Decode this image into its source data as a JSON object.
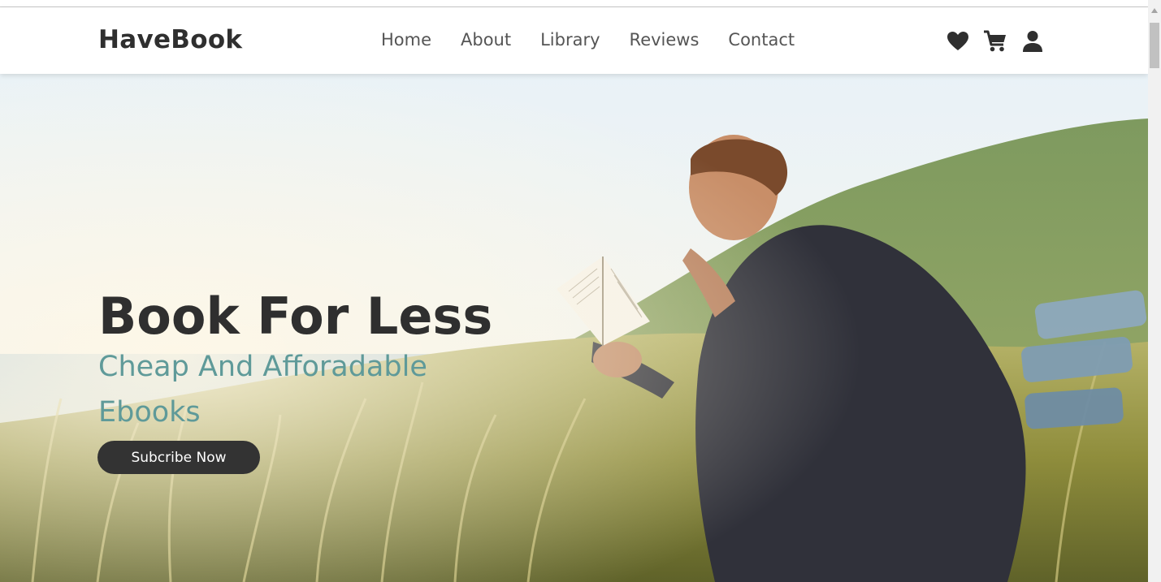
{
  "brand": {
    "name": "HaveBook"
  },
  "nav": {
    "items": [
      {
        "label": "Home"
      },
      {
        "label": "About"
      },
      {
        "label": "Library"
      },
      {
        "label": "Reviews"
      },
      {
        "label": "Contact"
      }
    ]
  },
  "header_icons": [
    "heart-icon",
    "cart-icon",
    "user-icon"
  ],
  "hero": {
    "title": "Book For Less",
    "subtitle": "Cheap And Afforadable Ebooks",
    "cta_label": "Subcribe Now",
    "background": "photo of a man reading a book in tall grass by the sea"
  },
  "colors": {
    "text_dark": "#2f2f2f",
    "nav_text": "#555555",
    "subtitle_teal": "#5f9a99",
    "button_bg": "#333333",
    "button_text": "#ffffff"
  }
}
